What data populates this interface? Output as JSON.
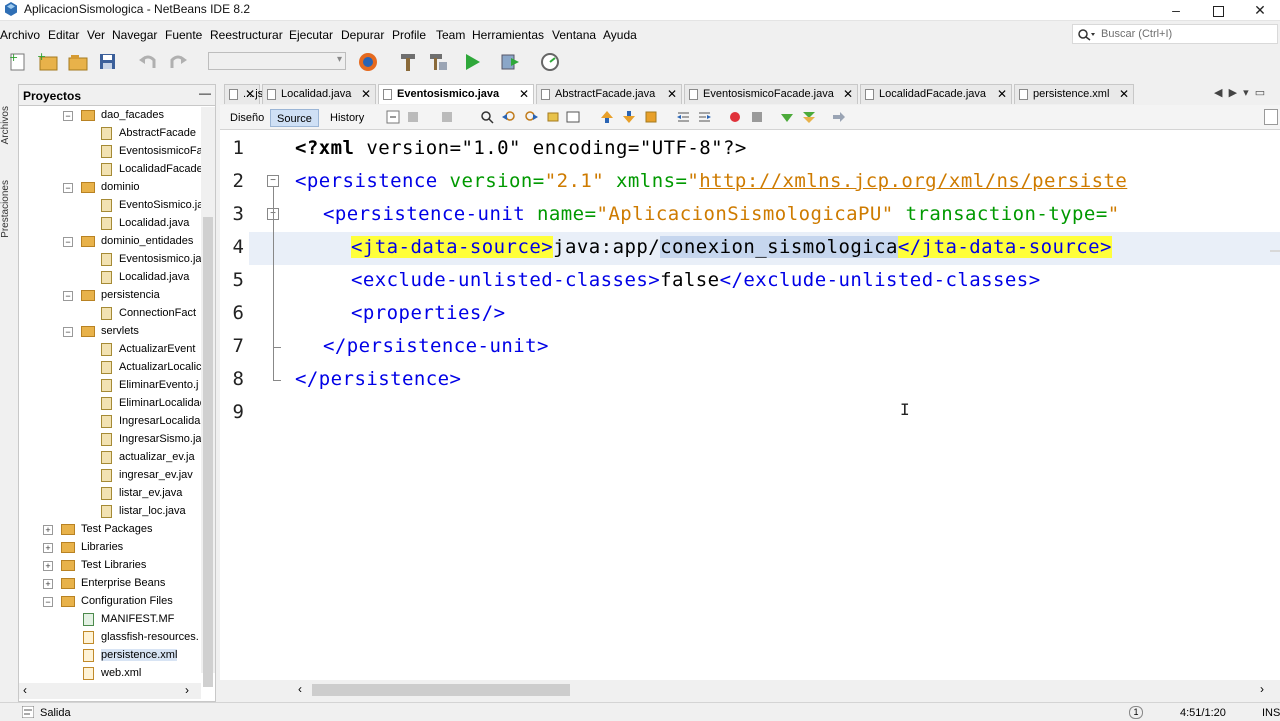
{
  "window": {
    "title": "AplicacionSismologica - NetBeans IDE 8.2"
  },
  "menu": [
    "Archivo",
    "Editar",
    "Ver",
    "Navegar",
    "Fuente",
    "Reestructurar",
    "Ejecutar",
    "Depurar",
    "Profile",
    "Team",
    "Herramientas",
    "Ventana",
    "Ayuda"
  ],
  "search": {
    "placeholder": "Buscar (Ctrl+I)"
  },
  "side_strip": {
    "archivos": "Archivos",
    "prestaciones": "Prestaciones"
  },
  "projects": {
    "title": "Proyectos",
    "minimize": "—",
    "tree": [
      {
        "label": "dao_facades",
        "kind": "package"
      },
      {
        "label": "AbstractFacade",
        "kind": "java"
      },
      {
        "label": "EventosismicoFa",
        "kind": "java"
      },
      {
        "label": "LocalidadFacade",
        "kind": "java"
      },
      {
        "label": "dominio",
        "kind": "package"
      },
      {
        "label": "EventoSismico.ja",
        "kind": "java"
      },
      {
        "label": "Localidad.java",
        "kind": "java"
      },
      {
        "label": "dominio_entidades",
        "kind": "package"
      },
      {
        "label": "Eventosismico.ja",
        "kind": "java"
      },
      {
        "label": "Localidad.java",
        "kind": "java"
      },
      {
        "label": "persistencia",
        "kind": "package"
      },
      {
        "label": "ConnectionFact",
        "kind": "java"
      },
      {
        "label": "servlets",
        "kind": "package"
      },
      {
        "label": "ActualizarEvent",
        "kind": "java"
      },
      {
        "label": "ActualizarLocalic",
        "kind": "java"
      },
      {
        "label": "EliminarEvento.j",
        "kind": "java"
      },
      {
        "label": "EliminarLocalidac",
        "kind": "java"
      },
      {
        "label": "IngresarLocalida",
        "kind": "java"
      },
      {
        "label": "IngresarSismo.ja",
        "kind": "java"
      },
      {
        "label": "actualizar_ev.ja",
        "kind": "java"
      },
      {
        "label": "ingresar_ev.jav",
        "kind": "java"
      },
      {
        "label": "listar_ev.java",
        "kind": "java"
      },
      {
        "label": "listar_loc.java",
        "kind": "java"
      },
      {
        "label": "Test Packages",
        "kind": "node"
      },
      {
        "label": "Libraries",
        "kind": "node"
      },
      {
        "label": "Test Libraries",
        "kind": "node"
      },
      {
        "label": "Enterprise Beans",
        "kind": "node"
      },
      {
        "label": "Configuration Files",
        "kind": "node"
      },
      {
        "label": "MANIFEST.MF",
        "kind": "mf"
      },
      {
        "label": "glassfish-resources.",
        "kind": "xml"
      },
      {
        "label": "persistence.xml",
        "kind": "xml"
      },
      {
        "label": "web.xml",
        "kind": "xml"
      }
    ]
  },
  "tabs": [
    {
      "label": "....jsp"
    },
    {
      "label": "Localidad.java"
    },
    {
      "label": "Eventosismico.java"
    },
    {
      "label": "AbstractFacade.java"
    },
    {
      "label": "EventosismicoFacade.java"
    },
    {
      "label": "LocalidadFacade.java"
    },
    {
      "label": "persistence.xml"
    }
  ],
  "tab_close": "✕",
  "editor_toolbar": {
    "design": "Diseño",
    "source": "Source",
    "history": "History"
  },
  "code": {
    "line_numbers": [
      "1",
      "2",
      "3",
      "4",
      "5",
      "6",
      "7",
      "8",
      "9"
    ],
    "l1": {
      "a": "<?xml",
      "b": " version=",
      "c": "\"1.0\"",
      "d": " encoding=",
      "e": "\"UTF-8\"",
      "f": "?>"
    },
    "l2": {
      "a": "<persistence",
      "b": " version=",
      "c": "\"2.1\"",
      "d": " xmlns=",
      "e": "\"",
      "f": "http://xmlns.jcp.org/xml/ns/persiste"
    },
    "l3": {
      "a": "<persistence-unit",
      "b": " name=",
      "c": "\"AplicacionSismologicaPU\"",
      "d": " transaction-type=",
      "e": "\""
    },
    "l4": {
      "a": "<jta-data-source>",
      "b": "java:app/",
      "c": "conexion_sismologica",
      "d": "</jta-data-source>"
    },
    "l5": {
      "a": "<exclude-unlisted-classes>",
      "b": "false",
      "c": "</exclude-unlisted-classes>"
    },
    "l6": {
      "a": "<properties/>"
    },
    "l7": {
      "a": "</persistence-unit>"
    },
    "l8": {
      "a": "</persistence>"
    }
  },
  "status": {
    "output": "Salida",
    "position": "4:51/1:20",
    "mode": "INS",
    "notifications": "1"
  }
}
